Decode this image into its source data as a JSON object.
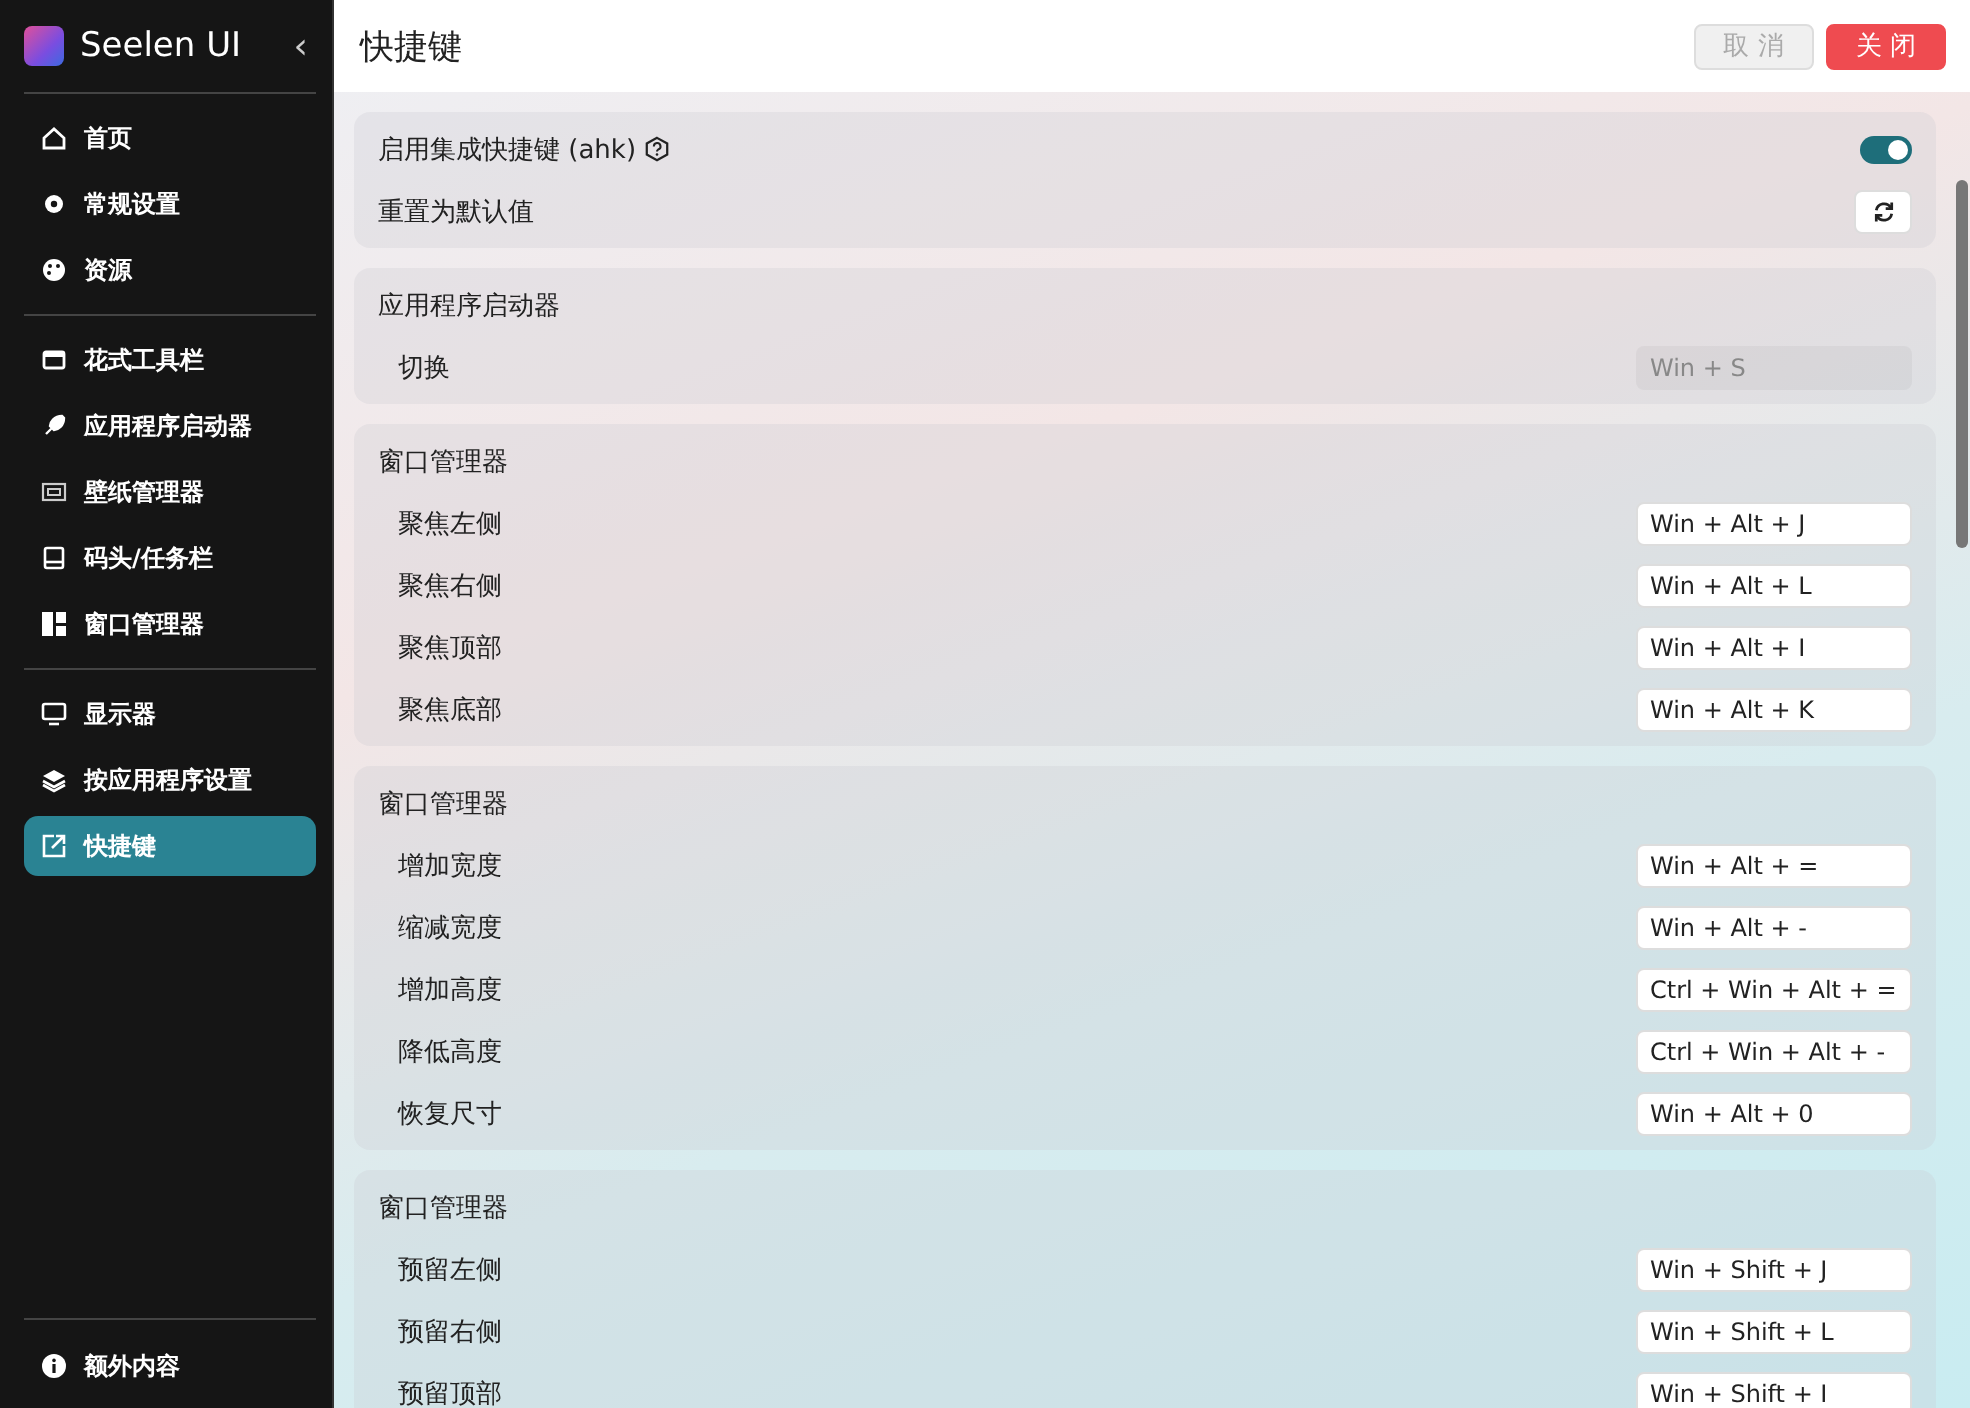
{
  "sidebar": {
    "app_name": "Seelen UI",
    "collapse": "‹",
    "groups": [
      [
        {
          "label": "首页",
          "selected": false
        },
        {
          "label": "常规设置",
          "selected": false
        },
        {
          "label": "资源",
          "selected": false
        }
      ],
      [
        {
          "label": "花式工具栏",
          "selected": false
        },
        {
          "label": "应用程序启动器",
          "selected": false
        },
        {
          "label": "壁纸管理器",
          "selected": false
        },
        {
          "label": "码头/任务栏",
          "selected": false
        },
        {
          "label": "窗口管理器",
          "selected": false
        }
      ],
      [
        {
          "label": "显示器",
          "selected": false
        },
        {
          "label": "按应用程序设置",
          "selected": false
        },
        {
          "label": "快捷键",
          "selected": true
        }
      ]
    ],
    "footer": {
      "label": "额外内容",
      "selected": false
    }
  },
  "header": {
    "title": "快捷键",
    "buttons": [
      {
        "label": "取 消",
        "kind": "cancel",
        "disabled": true
      },
      {
        "label": "关 闭",
        "kind": "close",
        "disabled": false
      }
    ]
  },
  "sections": [
    {
      "rows": [
        {
          "kind": "toggle",
          "label": "启用集成快捷键 (ahk)",
          "help": true,
          "on": true
        },
        {
          "kind": "reset",
          "label": "重置为默认值"
        }
      ]
    },
    {
      "title": "应用程序启动器",
      "rows": [
        {
          "kind": "shortcut",
          "label": "切换",
          "value": "Win + S",
          "disabled": true
        }
      ]
    },
    {
      "title": "窗口管理器",
      "rows": [
        {
          "kind": "shortcut",
          "label": "聚焦左侧",
          "value": "Win + Alt + J",
          "disabled": false
        },
        {
          "kind": "shortcut",
          "label": "聚焦右侧",
          "value": "Win + Alt + L",
          "disabled": false
        },
        {
          "kind": "shortcut",
          "label": "聚焦顶部",
          "value": "Win + Alt + I",
          "disabled": false
        },
        {
          "kind": "shortcut",
          "label": "聚焦底部",
          "value": "Win + Alt + K",
          "disabled": false
        }
      ]
    },
    {
      "title": "窗口管理器",
      "rows": [
        {
          "kind": "shortcut",
          "label": "增加宽度",
          "value": "Win + Alt + =",
          "disabled": false
        },
        {
          "kind": "shortcut",
          "label": "缩减宽度",
          "value": "Win + Alt + -",
          "disabled": false
        },
        {
          "kind": "shortcut",
          "label": "增加高度",
          "value": "Ctrl + Win + Alt + =",
          "disabled": false
        },
        {
          "kind": "shortcut",
          "label": "降低高度",
          "value": "Ctrl + Win + Alt + -",
          "disabled": false
        },
        {
          "kind": "shortcut",
          "label": "恢复尺寸",
          "value": "Win + Alt + 0",
          "disabled": false
        }
      ]
    },
    {
      "title": "窗口管理器",
      "rows": [
        {
          "kind": "shortcut",
          "label": "预留左侧",
          "value": "Win + Shift + J",
          "disabled": false
        },
        {
          "kind": "shortcut",
          "label": "预留右侧",
          "value": "Win + Shift + L",
          "disabled": false
        },
        {
          "kind": "shortcut",
          "label": "预留顶部",
          "value": "Win + Shift + I",
          "disabled": false
        }
      ]
    }
  ]
}
